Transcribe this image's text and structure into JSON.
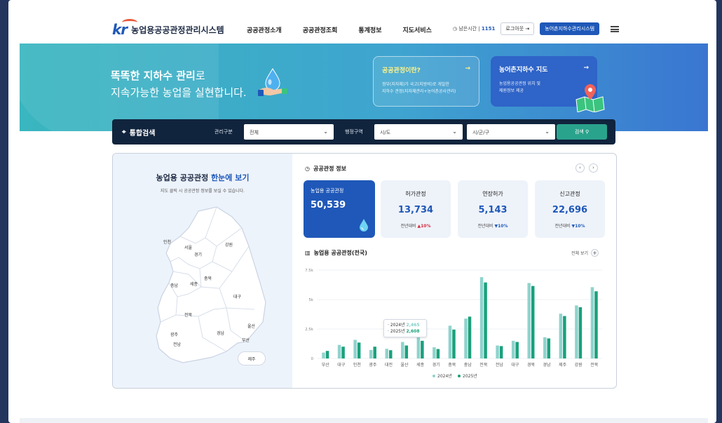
{
  "header": {
    "logo_text": "kr",
    "site_title": "농업용공공관정관리시스템",
    "nav": [
      "공공관정소개",
      "공공관정조회",
      "통계정보",
      "지도서비스"
    ],
    "remaining_label": "남은시간",
    "remaining_value": "1151",
    "login_label": "로그아웃",
    "system_button": "농어촌지하수관리시스템"
  },
  "hero": {
    "title_bold": "똑똑한 지하수 관리",
    "title_suffix": "로",
    "title_line2": "지속가능한 농업을 실현합니다.",
    "card_a": {
      "title": "공공관정이란?",
      "arrow": "→",
      "desc1": "정부(지자체)가 국고(지방비)로 개발한",
      "desc2": "지하수 관정(지자체관리+농어촌공사관리)"
    },
    "card_b": {
      "title": "농어촌지하수 지도",
      "arrow": "→",
      "desc1": "농업용공공관정 위치 및",
      "desc2": "제원정보 제공"
    }
  },
  "search": {
    "title": "통합검색",
    "label_mgmt": "관리구분",
    "mgmt_value": "전체",
    "label_region": "행정구역",
    "sido_placeholder": "시/도",
    "sigungu_placeholder": "시/군/구",
    "button": "검색"
  },
  "map": {
    "title_prefix": "농업용 공공관정",
    "title_highlight": "한눈에 보기",
    "subtitle": "지도 클릭 시 공공관정 정보를 보실 수 있습니다.",
    "regions": [
      "인천",
      "서울",
      "경기",
      "강원",
      "충북",
      "충남",
      "세종",
      "대구",
      "전북",
      "광주",
      "전남",
      "경남",
      "울산",
      "부산"
    ],
    "jeju": "제주"
  },
  "info": {
    "title": "공공관정 정보",
    "main": {
      "label": "농업용 공공관정",
      "value": "50,539"
    },
    "stats": [
      {
        "label": "허가관정",
        "value": "13,734",
        "compare_label": "전년대비",
        "change": "10%",
        "dir": "up"
      },
      {
        "label": "연장허가",
        "value": "5,143",
        "compare_label": "전년대비",
        "change": "10%",
        "dir": "down"
      },
      {
        "label": "신고관정",
        "value": "22,696",
        "compare_label": "전년대비",
        "change": "10%",
        "dir": "down"
      }
    ]
  },
  "chart_section": {
    "title": "농업용 공공관정(전국)",
    "view_all": "전체 보기",
    "tooltip": {
      "year1": "2024년",
      "value1": "2,465",
      "year2": "2025년",
      "value2": "2,608"
    }
  },
  "chart_data": {
    "type": "bar",
    "categories": [
      "부산",
      "대구",
      "인천",
      "광주",
      "대전",
      "울산",
      "세종",
      "경기",
      "충북",
      "충남",
      "전북",
      "전남",
      "대구",
      "경북",
      "경남",
      "제주",
      "강원",
      "전북"
    ],
    "series": [
      {
        "name": "2024년",
        "color": "#8fd3cd",
        "values": [
          500,
          1150,
          1580,
          720,
          820,
          1400,
          1850,
          950,
          2780,
          3380,
          6900,
          1100,
          1500,
          6400,
          1800,
          3800,
          4500,
          6050
        ]
      },
      {
        "name": "2025년",
        "color": "#1aa17b",
        "values": [
          640,
          1000,
          1350,
          1000,
          700,
          1100,
          1500,
          800,
          2450,
          3550,
          6450,
          1050,
          1400,
          6150,
          1700,
          3600,
          4350,
          5700
        ]
      }
    ],
    "yticks": [
      "0",
      "2.5k",
      "5k",
      "7.5k"
    ],
    "ylim": [
      0,
      7500
    ],
    "legend": "bottom"
  }
}
